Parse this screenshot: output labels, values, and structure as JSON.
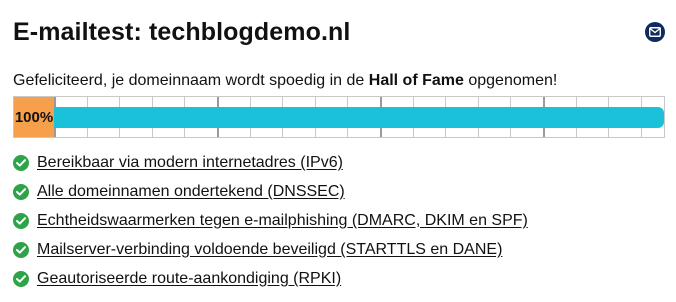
{
  "header": {
    "title": "E-mailtest: techblogdemo.nl",
    "mail_icon": "envelope-icon",
    "icon_color": "#0f2a5e"
  },
  "intro": {
    "prefix": "Gefeliciteerd, je domeinnaam wordt spoedig in de ",
    "highlight": "Hall of Fame",
    "suffix": " opgenomen!"
  },
  "score": {
    "label": "100%",
    "value": 100,
    "box_color": "#f6a04c",
    "bar_color": "#19c1d9"
  },
  "results": [
    {
      "label": "Bereikbaar via modern internetadres (IPv6)",
      "status": "pass",
      "icon": "check-circle-icon"
    },
    {
      "label": "Alle domeinnamen ondertekend (DNSSEC)",
      "status": "pass",
      "icon": "check-circle-icon"
    },
    {
      "label": "Echtheidswaarmerken tegen e-mailphishing (DMARC, DKIM en SPF)",
      "status": "pass",
      "icon": "check-circle-icon"
    },
    {
      "label": "Mailserver-verbinding voldoende beveiligd (STARTTLS en DANE)",
      "status": "pass",
      "icon": "check-circle-icon"
    },
    {
      "label": "Geautoriseerde route-aankondiging (RPKI)",
      "status": "pass",
      "icon": "check-circle-icon"
    }
  ],
  "colors": {
    "pass": "#2fa34a"
  }
}
